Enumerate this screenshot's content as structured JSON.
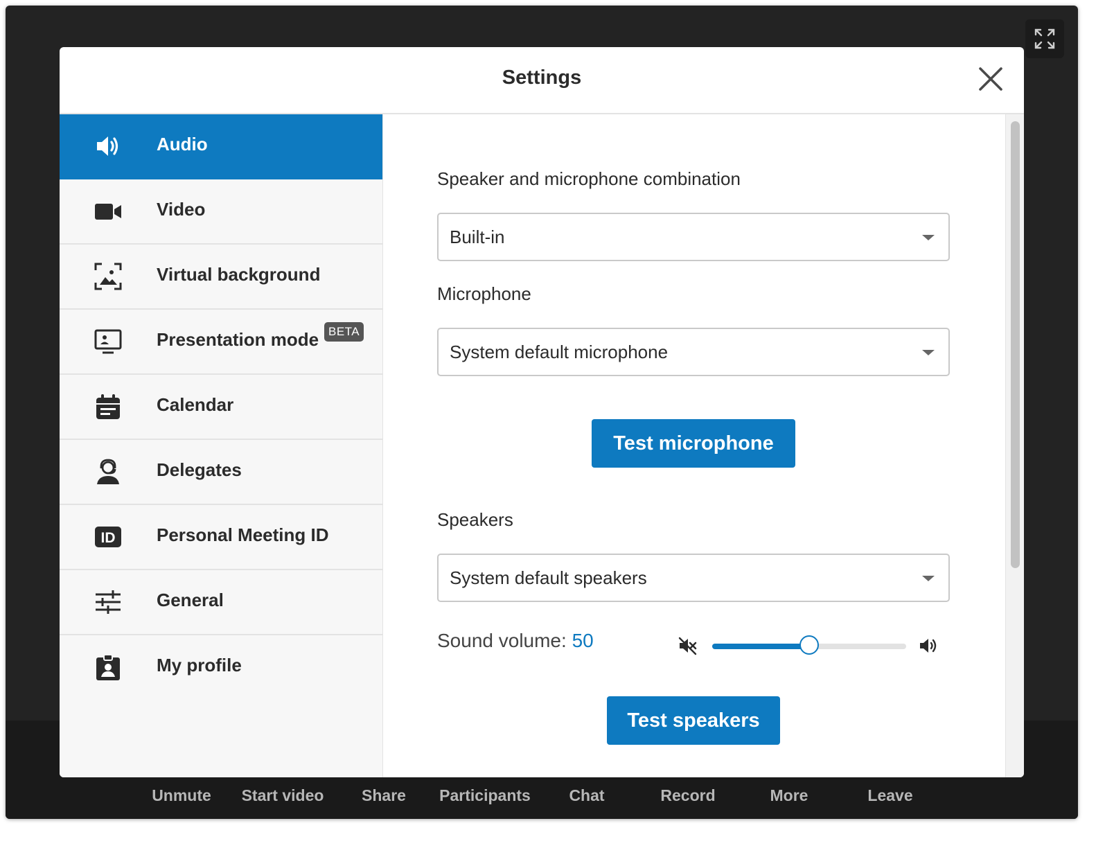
{
  "window": {
    "toolbar": [
      {
        "key": "unmute",
        "label": "Unmute"
      },
      {
        "key": "start_video",
        "label": "Start video"
      },
      {
        "key": "share",
        "label": "Share"
      },
      {
        "key": "participants",
        "label": "Participants"
      },
      {
        "key": "chat",
        "label": "Chat"
      },
      {
        "key": "record",
        "label": "Record"
      },
      {
        "key": "more",
        "label": "More"
      },
      {
        "key": "leave",
        "label": "Leave"
      }
    ],
    "fullscreen_icon": "expand-icon"
  },
  "modal": {
    "title": "Settings",
    "close_icon": "close-icon"
  },
  "sidebar": {
    "items": [
      {
        "key": "audio",
        "label": "Audio",
        "icon": "speaker-icon",
        "active": true
      },
      {
        "key": "video",
        "label": "Video",
        "icon": "video-camera-icon",
        "active": false
      },
      {
        "key": "virtual-background",
        "label": "Virtual background",
        "icon": "virtual-background-icon",
        "active": false
      },
      {
        "key": "presentation-mode",
        "label": "Presentation mode",
        "icon": "monitor-person-icon",
        "active": false,
        "badge": "BETA"
      },
      {
        "key": "calendar",
        "label": "Calendar",
        "icon": "calendar-icon",
        "active": false
      },
      {
        "key": "delegates",
        "label": "Delegates",
        "icon": "headset-person-icon",
        "active": false
      },
      {
        "key": "personal-meeting-id",
        "label": "Personal Meeting ID",
        "icon": "id-icon",
        "active": false
      },
      {
        "key": "general",
        "label": "General",
        "icon": "sliders-icon",
        "active": false
      },
      {
        "key": "my-profile",
        "label": "My profile",
        "icon": "id-badge-icon",
        "active": false
      }
    ]
  },
  "audio": {
    "combo_label": "Speaker and microphone combination",
    "combo_value": "Built-in",
    "mic_label": "Microphone",
    "mic_value": "System default microphone",
    "test_mic_label": "Test microphone",
    "speakers_label": "Speakers",
    "speakers_value": "System default speakers",
    "volume_label": "Sound volume:",
    "volume_value": "50",
    "volume_level": 0.5,
    "test_speakers_label": "Test speakers"
  },
  "colors": {
    "accent": "#0e7ac0",
    "app_background": "#232323",
    "sidebar_background": "#f7f7f7"
  }
}
